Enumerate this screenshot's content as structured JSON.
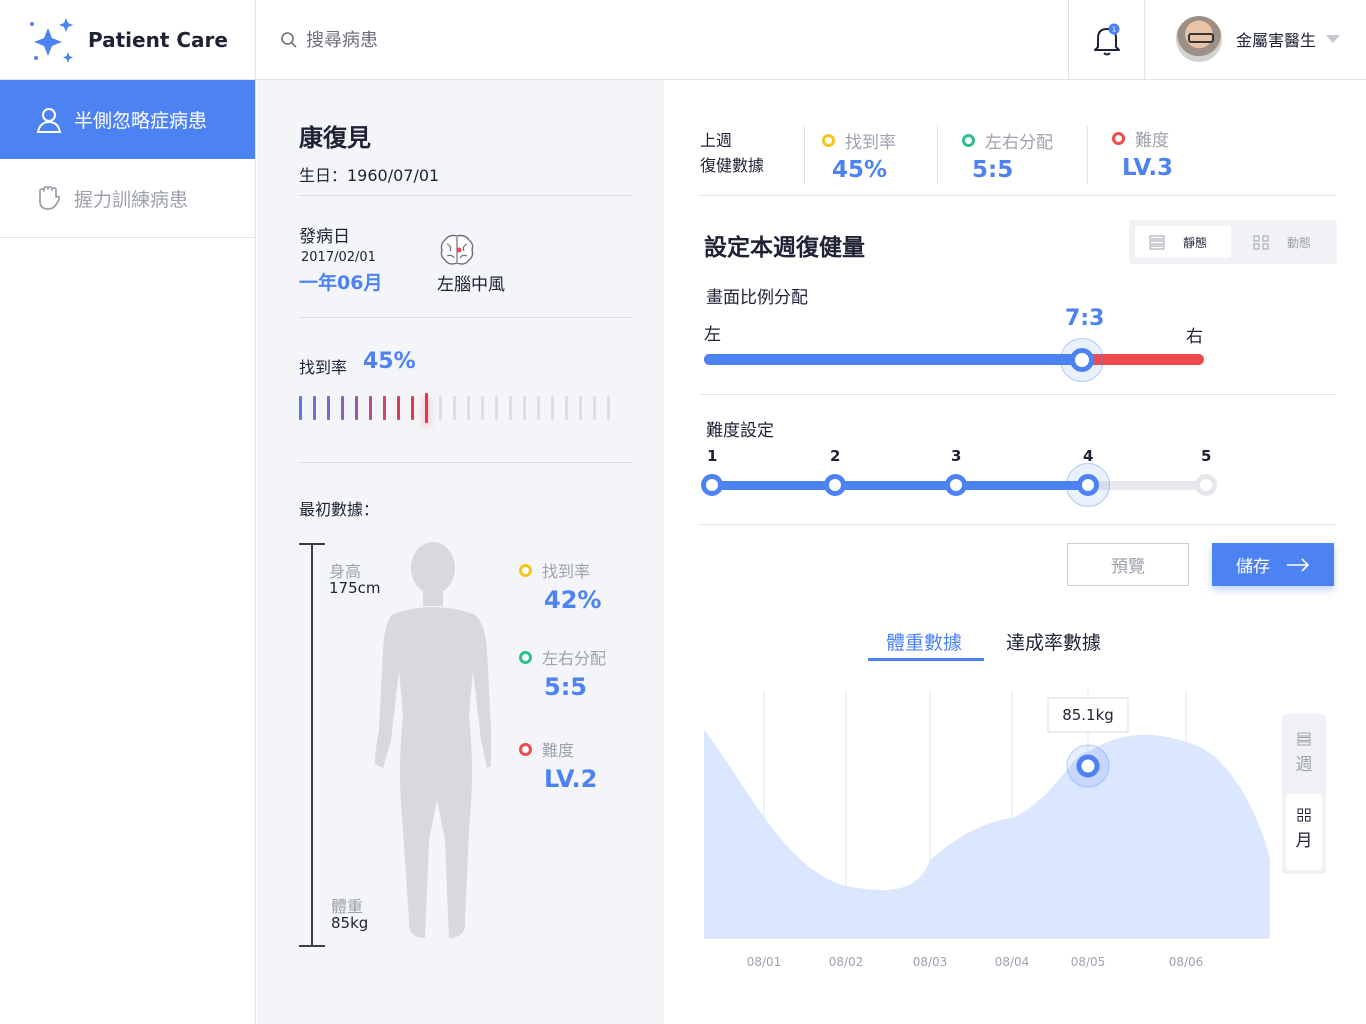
{
  "header": {
    "brand": "Patient Care",
    "search_placeholder": "搜尋病患",
    "notification_count": "1",
    "user_name": "金屬害醫生"
  },
  "sidebar": {
    "items": [
      {
        "label": "半側忽略症病患",
        "active": true,
        "icon": "person-icon"
      },
      {
        "label": "握力訓練病患",
        "active": false,
        "icon": "hand-icon"
      }
    ]
  },
  "patient": {
    "name": "康復見",
    "birth": "生日：1960/07/01",
    "onset_label": "發病日",
    "onset_date": "2017/02/01",
    "onset_duration": "一年06月",
    "diagnosis": "左腦中風",
    "find_rate_label": "找到率",
    "find_rate": "45%",
    "find_rate_fraction": 0.45,
    "initial_label": "最初數據：",
    "height_label": "身高",
    "height_value": "175cm",
    "weight_label": "體重",
    "weight_value": "85kg",
    "initial_stats": [
      {
        "label": "找到率",
        "value": "42%",
        "color": "#f5c518"
      },
      {
        "label": "左右分配",
        "value": "5:5",
        "color": "#2ec08a"
      },
      {
        "label": "難度",
        "value": "LV.2",
        "color": "#f04a4a"
      }
    ]
  },
  "last_week": {
    "title_line1": "上週",
    "title_line2": "復健數據",
    "stats": [
      {
        "label": "找到率",
        "value": "45%",
        "color": "#f5c518"
      },
      {
        "label": "左右分配",
        "value": "5:5",
        "color": "#2ec08a"
      },
      {
        "label": "難度",
        "value": "LV.3",
        "color": "#f04a4a"
      }
    ]
  },
  "settings": {
    "title": "設定本週復健量",
    "toggle": {
      "static_label": "靜態",
      "dynamic_label": "動態",
      "selected": "靜態"
    },
    "ratio_label": "畫面比例分配",
    "left_label": "左",
    "right_label": "右",
    "ratio_value": "7:3",
    "ratio_left_fraction": 0.7,
    "difficulty_label": "難度設定",
    "difficulty_levels": [
      "1",
      "2",
      "3",
      "4",
      "5"
    ],
    "difficulty_selected": 4,
    "preview_label": "預覽",
    "save_label": "儲存"
  },
  "chart_tabs": {
    "active": "體重數據",
    "inactive": "達成率數據"
  },
  "period_toggle": {
    "week_label": "週",
    "month_label": "月",
    "selected": "月"
  },
  "colors": {
    "accent": "#4d82f3",
    "danger": "#f04a4a",
    "warning": "#f5c518",
    "success": "#2ec08a"
  },
  "chart_data": {
    "type": "area",
    "x": [
      "08/01",
      "08/02",
      "08/03",
      "08/04",
      "08/05",
      "08/06"
    ],
    "tooltip_label": "85.1kg",
    "highlighted_x": "08/05",
    "highlighted_value": 85.1
  }
}
